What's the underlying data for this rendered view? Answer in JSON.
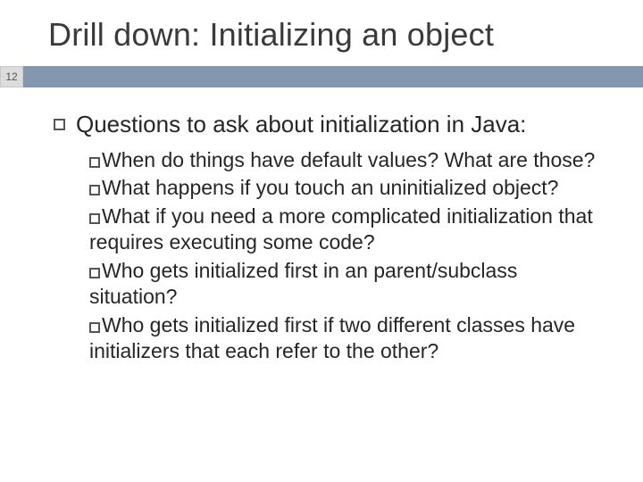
{
  "title": "Drill down: Initializing an object",
  "page": "12",
  "heading": "Questions to ask about initialization in Java:",
  "items": [
    "When do things have default values?  What are those?",
    "What happens if you touch an uninitialized object?",
    "What if you need a more complicated initialization that requires executing some code?",
    "Who gets initialized first in an parent/subclass situation?",
    "Who gets initialized first if two different classes have initializers that each refer to the other?"
  ]
}
